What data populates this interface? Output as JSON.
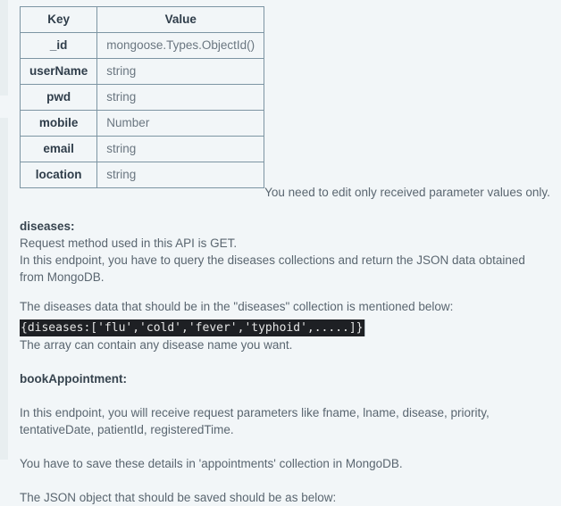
{
  "schema_table": {
    "headers": [
      "Key",
      "Value"
    ],
    "rows": [
      {
        "key": "_id",
        "value": "mongoose.Types.ObjectId()"
      },
      {
        "key": "userName",
        "value": "string"
      },
      {
        "key": "pwd",
        "value": "string"
      },
      {
        "key": "mobile",
        "value": "Number"
      },
      {
        "key": "email",
        "value": "string"
      },
      {
        "key": "location",
        "value": "string"
      }
    ]
  },
  "notes": {
    "edit_note": "You need to edit only received parameter values only."
  },
  "diseases_section": {
    "heading": "diseases:",
    "line_method": "Request method used in this API is GET.",
    "line_endpoint": "In this endpoint, you have to query the diseases collections and return the JSON data obtained from MongoDB.",
    "line_data_intro": "The diseases data that should be in the \"diseases\" collection is mentioned below:",
    "code": "{diseases:['flu','cold','fever','typhoid',.....]}",
    "line_array_note": "The array can contain any disease name you want."
  },
  "book_appointment_section": {
    "heading": "bookAppointment:",
    "line_params": "In this endpoint, you will receive request parameters like fname, lname, disease, priority, tentativeDate, patientId, registeredTime.",
    "line_save": "You have to save these details in 'appointments' collection in MongoDB.",
    "line_json_intro": "The JSON object that should be saved should be as below:"
  },
  "colors": {
    "page_background": "#f2f6f8",
    "table_border": "#7d95a3",
    "heading_text": "#37444f",
    "body_text": "#5a6670",
    "value_text": "#6a7680",
    "code_background": "#1e2024",
    "code_text": "#e6e6e6"
  }
}
